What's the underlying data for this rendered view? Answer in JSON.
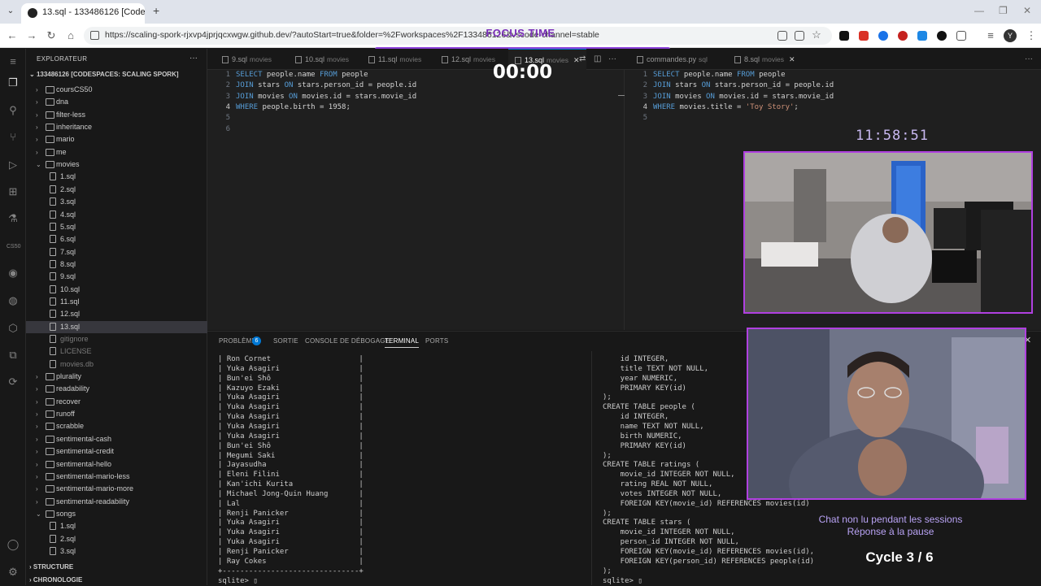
{
  "browser": {
    "tab_title": "13.sql - 133486126 [Codespace",
    "url": "https://scaling-spork-rjxvp4jprjqcxwgw.github.dev/?autoStart=true&folder=%2Fworkspaces%2F133486126&vscode-channel=stable",
    "avatar_letter": "Y"
  },
  "overlay": {
    "focus_title": "FOCUS TIME",
    "timer": "00:00",
    "clock": "11:58:51",
    "chat_line1": "Chat non lu pendant les sessions",
    "chat_line2": "Réponse à la pause",
    "cycle": "Cycle 3 / 6"
  },
  "sidebar": {
    "header": "EXPLORATEUR",
    "root": "133486126 [CODESPACES: SCALING SPORK]",
    "tree": [
      {
        "label": "coursCS50",
        "type": "folder",
        "open": false,
        "depth": 0
      },
      {
        "label": "dna",
        "type": "folder",
        "open": false,
        "depth": 0
      },
      {
        "label": "filter-less",
        "type": "folder",
        "open": false,
        "depth": 0
      },
      {
        "label": "inheritance",
        "type": "folder",
        "open": false,
        "depth": 0
      },
      {
        "label": "mario",
        "type": "folder",
        "open": false,
        "depth": 0
      },
      {
        "label": "me",
        "type": "folder",
        "open": false,
        "depth": 0
      },
      {
        "label": "movies",
        "type": "folder",
        "open": true,
        "depth": 0
      },
      {
        "label": "1.sql",
        "type": "file",
        "depth": 1
      },
      {
        "label": "2.sql",
        "type": "file",
        "depth": 1
      },
      {
        "label": "3.sql",
        "type": "file",
        "depth": 1
      },
      {
        "label": "4.sql",
        "type": "file",
        "depth": 1
      },
      {
        "label": "5.sql",
        "type": "file",
        "depth": 1
      },
      {
        "label": "6.sql",
        "type": "file",
        "depth": 1
      },
      {
        "label": "7.sql",
        "type": "file",
        "depth": 1
      },
      {
        "label": "8.sql",
        "type": "file",
        "depth": 1
      },
      {
        "label": "9.sql",
        "type": "file",
        "depth": 1
      },
      {
        "label": "10.sql",
        "type": "file",
        "depth": 1
      },
      {
        "label": "11.sql",
        "type": "file",
        "depth": 1
      },
      {
        "label": "12.sql",
        "type": "file",
        "depth": 1
      },
      {
        "label": "13.sql",
        "type": "file",
        "depth": 1,
        "selected": true
      },
      {
        "label": "gitignore",
        "type": "file",
        "depth": 1,
        "dim": true
      },
      {
        "label": "LICENSE",
        "type": "file",
        "depth": 1,
        "dim": true
      },
      {
        "label": "movies.db",
        "type": "file",
        "depth": 1,
        "dim": true
      },
      {
        "label": "plurality",
        "type": "folder",
        "open": false,
        "depth": 0
      },
      {
        "label": "readability",
        "type": "folder",
        "open": false,
        "depth": 0
      },
      {
        "label": "recover",
        "type": "folder",
        "open": false,
        "depth": 0
      },
      {
        "label": "runoff",
        "type": "folder",
        "open": false,
        "depth": 0
      },
      {
        "label": "scrabble",
        "type": "folder",
        "open": false,
        "depth": 0
      },
      {
        "label": "sentimental-cash",
        "type": "folder",
        "open": false,
        "depth": 0
      },
      {
        "label": "sentimental-credit",
        "type": "folder",
        "open": false,
        "depth": 0
      },
      {
        "label": "sentimental-hello",
        "type": "folder",
        "open": false,
        "depth": 0
      },
      {
        "label": "sentimental-mario-less",
        "type": "folder",
        "open": false,
        "depth": 0
      },
      {
        "label": "sentimental-mario-more",
        "type": "folder",
        "open": false,
        "depth": 0
      },
      {
        "label": "sentimental-readability",
        "type": "folder",
        "open": false,
        "depth": 0
      },
      {
        "label": "songs",
        "type": "folder",
        "open": true,
        "depth": 0
      },
      {
        "label": "1.sql",
        "type": "file",
        "depth": 1
      },
      {
        "label": "2.sql",
        "type": "file",
        "depth": 1
      },
      {
        "label": "3.sql",
        "type": "file",
        "depth": 1
      }
    ],
    "structure": "STRUCTURE",
    "timeline": "CHRONOLOGIE"
  },
  "editor_tabs": [
    {
      "name": "9.sql",
      "ext": "movies"
    },
    {
      "name": "10.sql",
      "ext": "movies"
    },
    {
      "name": "11.sql",
      "ext": "movies"
    },
    {
      "name": "12.sql",
      "ext": "movies"
    },
    {
      "name": "13.sql",
      "ext": "movies",
      "active": true
    },
    {
      "name": "commandes.py",
      "ext": "sql"
    },
    {
      "name": "8.sql",
      "ext": "movies"
    }
  ],
  "editor_left": {
    "lines": [
      [
        {
          "t": "SELECT",
          "k": 1
        },
        {
          "t": " people.name "
        },
        {
          "t": "FROM",
          "k": 1
        },
        {
          "t": " people"
        }
      ],
      [
        {
          "t": "JOIN",
          "k": 1
        },
        {
          "t": " stars "
        },
        {
          "t": "ON",
          "k": 1
        },
        {
          "t": " stars.person_id = people.id"
        }
      ],
      [
        {
          "t": "JOIN",
          "k": 1
        },
        {
          "t": " movies "
        },
        {
          "t": "ON",
          "k": 1
        },
        {
          "t": " movies.id = stars.movie_id"
        }
      ],
      [
        {
          "t": "WHERE",
          "k": 1
        },
        {
          "t": " people.birth = 1958;"
        }
      ],
      [],
      []
    ],
    "current_line": 4
  },
  "editor_right": {
    "lines": [
      [
        {
          "t": "SELECT",
          "k": 1
        },
        {
          "t": " people.name "
        },
        {
          "t": "FROM",
          "k": 1
        },
        {
          "t": " people"
        }
      ],
      [
        {
          "t": "JOIN",
          "k": 1
        },
        {
          "t": " stars "
        },
        {
          "t": "ON",
          "k": 1
        },
        {
          "t": " stars.person_id = people.id"
        }
      ],
      [
        {
          "t": "JOIN",
          "k": 1
        },
        {
          "t": " movies "
        },
        {
          "t": "ON",
          "k": 1
        },
        {
          "t": " movies.id = stars.movie_id"
        }
      ],
      [
        {
          "t": "WHERE",
          "k": 1
        },
        {
          "t": " movies.title = "
        },
        {
          "t": "'Toy Story'",
          "s": 1
        },
        {
          "t": ";"
        }
      ],
      []
    ],
    "current_line": 4
  },
  "panel": {
    "tabs": [
      "PROBLÈMES",
      "SORTIE",
      "CONSOLE DE DÉBOGAGE",
      "TERMINAL",
      "PORTS"
    ],
    "active": "TERMINAL",
    "problems_count": "6"
  },
  "terminal_left": [
    "| Ron Cornet                    |",
    "| Yuka Asagiri                  |",
    "| Bun'ei Shô                    |",
    "| Kazuyo Ezaki                  |",
    "| Yuka Asagiri                  |",
    "| Yuka Asagiri                  |",
    "| Yuka Asagiri                  |",
    "| Yuka Asagiri                  |",
    "| Yuka Asagiri                  |",
    "| Bun'ei Shô                    |",
    "| Megumi Saki                   |",
    "| Jayasudha                     |",
    "| Eleni Filini                  |",
    "| Kan'ichi Kurita               |",
    "| Michael Jong-Quin Huang       |",
    "| Lal                           |",
    "| Renji Panicker                |",
    "| Yuka Asagiri                  |",
    "| Yuka Asagiri                  |",
    "| Yuka Asagiri                  |",
    "| Renji Panicker                |",
    "| Ray Cokes                     |",
    "+-------------------------------+",
    "sqlite> ▯"
  ],
  "terminal_right": [
    "    id INTEGER,",
    "    title TEXT NOT NULL,",
    "    year NUMERIC,",
    "    PRIMARY KEY(id)",
    ");",
    "CREATE TABLE people (",
    "    id INTEGER,",
    "    name TEXT NOT NULL,",
    "    birth NUMERIC,",
    "    PRIMARY KEY(id)",
    ");",
    "CREATE TABLE ratings (",
    "    movie_id INTEGER NOT NULL,",
    "    rating REAL NOT NULL,",
    "    votes INTEGER NOT NULL,",
    "    FOREIGN KEY(movie_id) REFERENCES movies(id)",
    ");",
    "CREATE TABLE stars (",
    "    movie_id INTEGER NOT NULL,",
    "    person_id INTEGER NOT NULL,",
    "    FOREIGN KEY(movie_id) REFERENCES movies(id),",
    "    FOREIGN KEY(person_id) REFERENCES people(id)",
    ");",
    "sqlite> ▯"
  ],
  "colors": {
    "keyword": "#569cd6",
    "string": "#ce9178",
    "accent": "#8a3fd8",
    "cam_border": "#b040e0"
  }
}
